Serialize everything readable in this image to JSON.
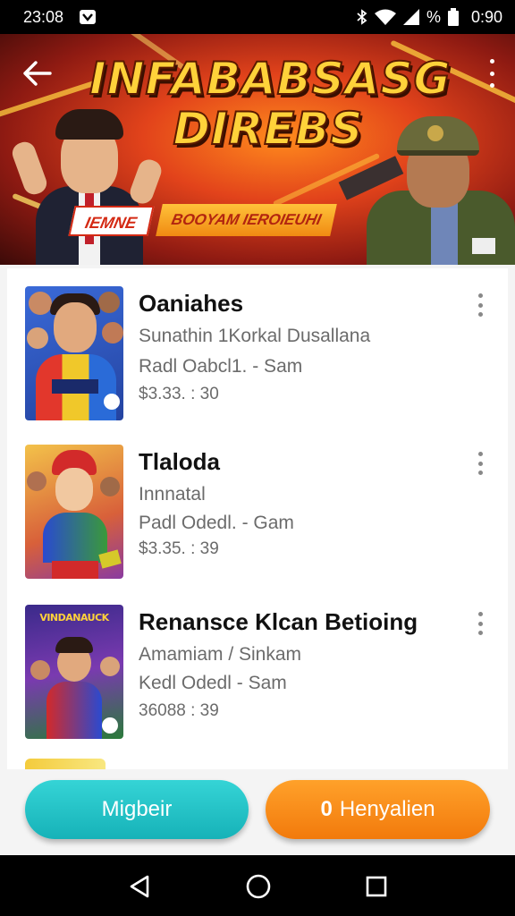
{
  "status_bar": {
    "time": "23:08",
    "battery": "%",
    "clock_right": "0:90"
  },
  "banner": {
    "title_line1": "INFABABSASG",
    "title_line2": "DIREBS",
    "tag_left": "IEMNE",
    "tag_right": "BOOYAM IEROIEUHI"
  },
  "games": [
    {
      "title": "Oaniahes",
      "subtitle": "Sunathin 1Korkal Dusallana",
      "meta": "Radl Oabcl1. - Sam",
      "price": "$3.33. : 30"
    },
    {
      "title": "Tlaloda",
      "subtitle": "Innnatal",
      "meta": "Padl Odedl. - Gam",
      "price": "$3.35. : 39"
    },
    {
      "title": "Renansce Klcan Betioing",
      "subtitle": "Amamiam / Sinkam",
      "meta": "Kedl Odedl - Sam",
      "price": "36088 : 39"
    }
  ],
  "thumb_badge_3": "VINDANAUCK",
  "buttons": {
    "left": "Migbeir",
    "right_icon": "0",
    "right": "Henyalien"
  },
  "colors": {
    "accent_teal": "#1fbfc3",
    "accent_orange": "#f6861a"
  }
}
